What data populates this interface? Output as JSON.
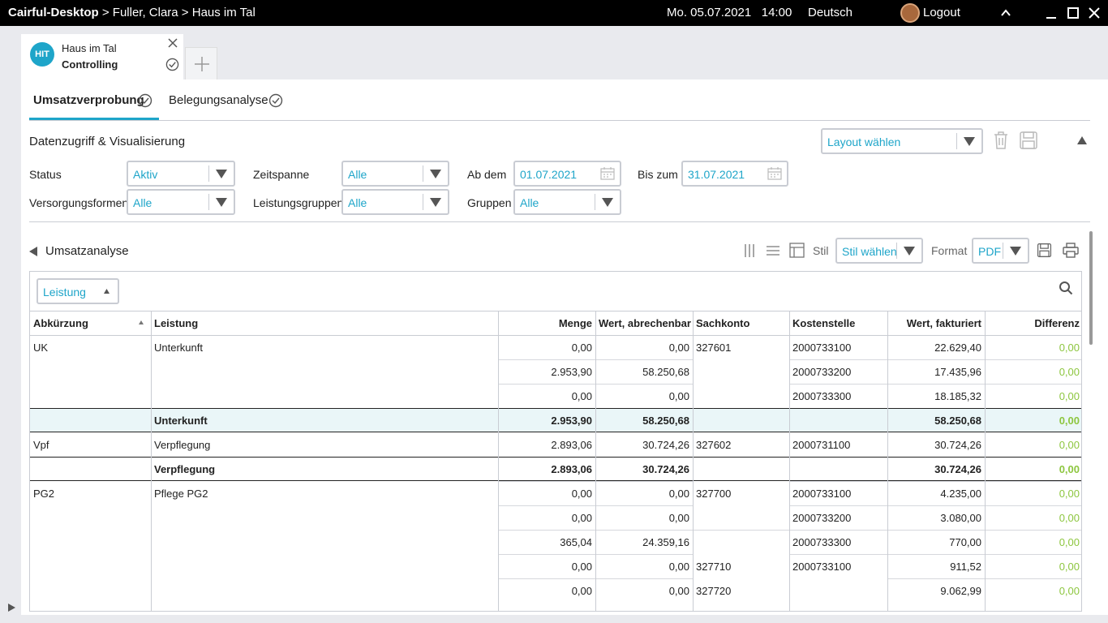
{
  "titlebar": {
    "app": "Cairful-Desktop",
    "crumbs": " > Fuller, Clara > Haus im Tal",
    "datetime": "Mo. 05.07.2021   14:00",
    "language": "Deutsch",
    "logout": "Logout"
  },
  "tab": {
    "badge": "HIT",
    "title": "Haus im Tal",
    "subtitle": "Controlling"
  },
  "subtabs": [
    {
      "label": "Umsatzverprobung"
    },
    {
      "label": "Belegungsanalyse"
    }
  ],
  "filter": {
    "title": "Datenzugriff & Visualisierung",
    "layout_placeholder": "Layout wählen",
    "status_label": "Status",
    "status_value": "Aktiv",
    "zeitspanne_label": "Zeitspanne",
    "zeitspanne_value": "Alle",
    "abdem_label": "Ab dem",
    "abdem_value": "01.07.2021",
    "biszum_label": "Bis zum",
    "biszum_value": "31.07.2021",
    "versorgung_label": "Versorgungsformen",
    "versorgung_value": "Alle",
    "leistungsgruppen_label": "Leistungsgruppen",
    "leistungsgruppen_value": "Alle",
    "gruppen_label": "Gruppen",
    "gruppen_value": "Alle"
  },
  "analysis": {
    "title": "Umsatzanalyse",
    "stil_label": "Stil",
    "stil_value": "Stil wählen",
    "format_label": "Format",
    "format_value": "PDF",
    "group_chip": "Leistung"
  },
  "table": {
    "headers": [
      "Abkürzung",
      "Leistung",
      "Menge",
      "Wert, abrechenbar",
      "Sachkonto",
      "Kostenstelle",
      "Wert, fakturiert",
      "Differenz"
    ],
    "rows": [
      {
        "abk": "UK",
        "leistung": "Unterkunft",
        "menge": "0,00",
        "wert": "0,00",
        "konto": "327601",
        "kst": "2000733100",
        "fakt": "22.629,40",
        "diff": "0,00"
      },
      {
        "abk": "",
        "leistung": "",
        "menge": "2.953,90",
        "wert": "58.250,68",
        "konto": "",
        "kst": "2000733200",
        "fakt": "17.435,96",
        "diff": "0,00"
      },
      {
        "abk": "",
        "leistung": "",
        "menge": "0,00",
        "wert": "0,00",
        "konto": "",
        "kst": "2000733300",
        "fakt": "18.185,32",
        "diff": "0,00"
      },
      {
        "abk": "",
        "leistung": "Unterkunft",
        "menge": "2.953,90",
        "wert": "58.250,68",
        "konto": "",
        "kst": "",
        "fakt": "58.250,68",
        "diff": "0,00",
        "sum": true
      },
      {
        "abk": "Vpf",
        "leistung": "Verpflegung",
        "menge": "2.893,06",
        "wert": "30.724,26",
        "konto": "327602",
        "kst": "2000731100",
        "fakt": "30.724,26",
        "diff": "0,00"
      },
      {
        "abk": "",
        "leistung": "Verpflegung",
        "menge": "2.893,06",
        "wert": "30.724,26",
        "konto": "",
        "kst": "",
        "fakt": "30.724,26",
        "diff": "0,00",
        "sum": true
      },
      {
        "abk": "PG2",
        "leistung": "Pflege PG2",
        "menge": "0,00",
        "wert": "0,00",
        "konto": "327700",
        "kst": "2000733100",
        "fakt": "4.235,00",
        "diff": "0,00"
      },
      {
        "abk": "",
        "leistung": "",
        "menge": "0,00",
        "wert": "0,00",
        "konto": "",
        "kst": "2000733200",
        "fakt": "3.080,00",
        "diff": "0,00"
      },
      {
        "abk": "",
        "leistung": "",
        "menge": "365,04",
        "wert": "24.359,16",
        "konto": "",
        "kst": "2000733300",
        "fakt": "770,00",
        "diff": "0,00"
      },
      {
        "abk": "",
        "leistung": "",
        "menge": "0,00",
        "wert": "0,00",
        "konto": "327710",
        "kst": "2000733100",
        "fakt": "911,52",
        "diff": "0,00"
      },
      {
        "abk": "",
        "leistung": "",
        "menge": "0,00",
        "wert": "0,00",
        "konto": "327720",
        "kst": "",
        "fakt": "9.062,99",
        "diff": "0,00"
      }
    ]
  },
  "colors": {
    "accent": "#1ea5c9",
    "positive": "#8dc63f",
    "sum_highlight": "#eaf6f8"
  }
}
